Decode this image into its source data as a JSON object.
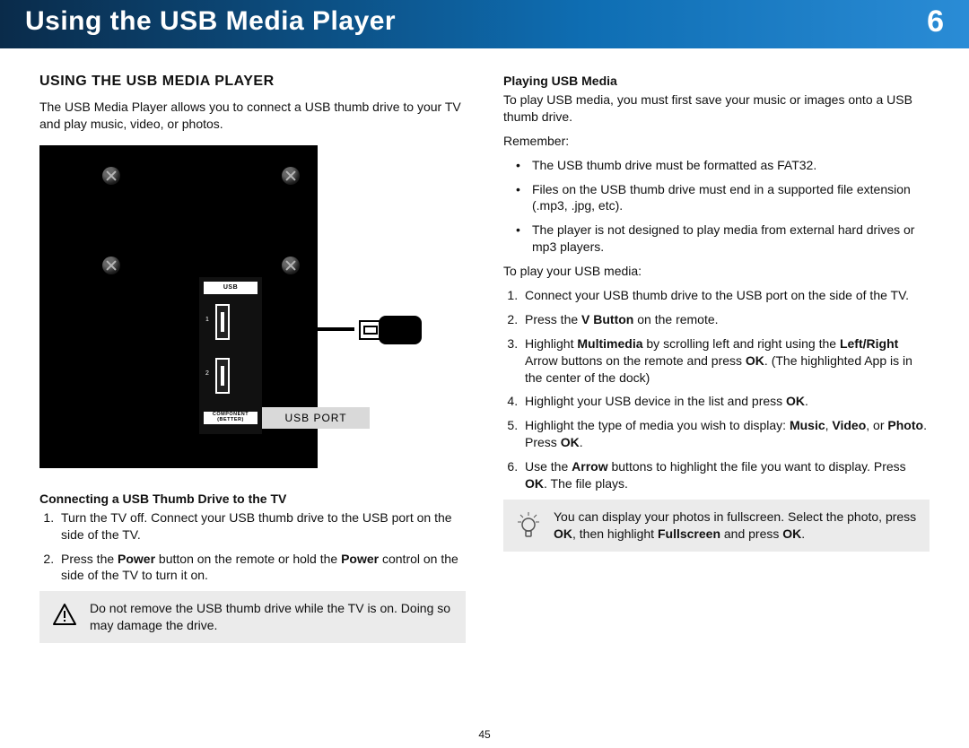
{
  "header": {
    "title": "Using the USB Media Player",
    "chapter_number": "6"
  },
  "page_number": "45",
  "left": {
    "section_heading": "USING THE USB MEDIA PLAYER",
    "intro": "The USB Media Player allows you to connect a USB thumb drive to your TV and play music, video, or photos.",
    "figure": {
      "usb_label": "USB",
      "component_label_1": "COMPONENT",
      "component_label_2": "(BETTER)",
      "port1_num": "1",
      "port2_num": "2",
      "callout_label": "USB PORT"
    },
    "sub_connect_heading": "Connecting a USB Thumb Drive to the TV",
    "connect_step1": "Turn the TV off. Connect your USB thumb drive to the USB port on the side of the TV.",
    "connect_step2_a": "Press the ",
    "connect_step2_b": "Power",
    "connect_step2_c": " button on the remote or hold the ",
    "connect_step2_d": "Power",
    "connect_step2_e": " control on the side of the TV to turn it on.",
    "warn": "Do not remove the USB thumb drive while the TV is on. Doing so may damage the drive."
  },
  "right": {
    "sub_play_heading": "Playing USB Media",
    "play_intro": "To play USB media, you must first save your music or images onto a USB thumb drive.",
    "remember_label": "Remember:",
    "bul1": "The USB thumb drive must be formatted as FAT32.",
    "bul2": "Files on the USB thumb drive must end in a supported file extension (.mp3, .jpg, etc).",
    "bul3": "The player is not designed to play media from external hard drives or mp3 players.",
    "steps_intro": "To play your USB media:",
    "s1": "Connect your USB thumb drive to the USB port on the side of the TV.",
    "s2_a": "Press the ",
    "s2_b": "V Button",
    "s2_c": " on the remote.",
    "s3_a": "Highlight ",
    "s3_b": "Multimedia",
    "s3_c": " by scrolling left and right using the ",
    "s3_d": "Left/Right",
    "s3_e": " Arrow buttons on the remote and press ",
    "s3_f": "OK",
    "s3_g": ". (The highlighted App is in the center of the dock)",
    "s4_a": "Highlight your USB device in the list and press ",
    "s4_b": "OK",
    "s4_c": ".",
    "s5_a": "Highlight the type of media you wish to display: ",
    "s5_b": "Music",
    "s5_c": ", ",
    "s5_d": "Video",
    "s5_e": ", or ",
    "s5_f": "Photo",
    "s5_g": ". Press ",
    "s5_h": "OK",
    "s5_i": ".",
    "s6_a": "Use the ",
    "s6_b": "Arrow",
    "s6_c": " buttons to highlight the file you want to display. Press ",
    "s6_d": "OK",
    "s6_e": ". The file plays.",
    "tip_a": "You can display your photos in fullscreen. Select the photo, press ",
    "tip_b": "OK",
    "tip_c": ", then highlight ",
    "tip_d": "Fullscreen",
    "tip_e": " and press ",
    "tip_f": "OK",
    "tip_g": "."
  }
}
